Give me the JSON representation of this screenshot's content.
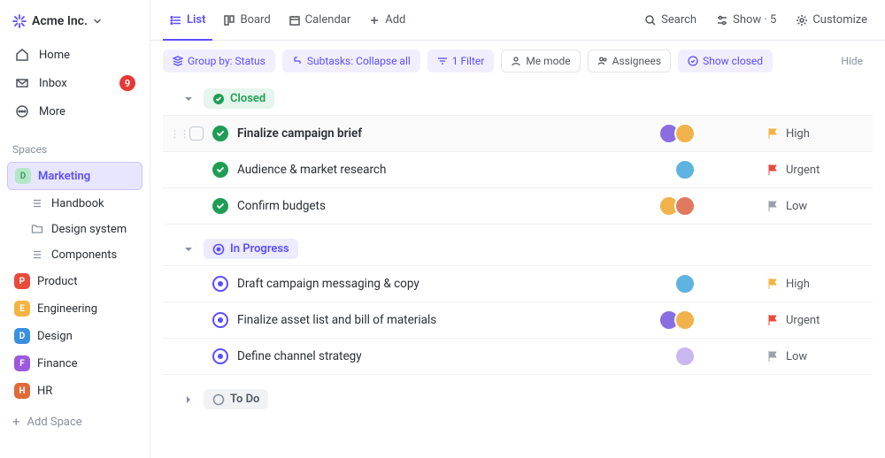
{
  "workspace": {
    "name": "Acme Inc."
  },
  "nav": {
    "home": "Home",
    "inbox": "Inbox",
    "inbox_badge": "9",
    "more": "More"
  },
  "spaces_label": "Spaces",
  "add_space": "Add Space",
  "spaces": [
    {
      "letter": "D",
      "color": "#b4e7c8",
      "text": "#3a9e5f",
      "label": "Marketing",
      "active": true,
      "children": [
        {
          "icon": "list",
          "label": "Handbook"
        },
        {
          "icon": "folder",
          "label": "Design system"
        },
        {
          "icon": "list",
          "label": "Components"
        }
      ]
    },
    {
      "letter": "P",
      "color": "#e84b3c",
      "label": "Product"
    },
    {
      "letter": "E",
      "color": "#f5b342",
      "label": "Engineering"
    },
    {
      "letter": "D",
      "color": "#3a8fe0",
      "label": "Design"
    },
    {
      "letter": "F",
      "color": "#9b59e0",
      "label": "Finance"
    },
    {
      "letter": "H",
      "color": "#e06a3a",
      "label": "HR"
    }
  ],
  "views": [
    {
      "icon": "list",
      "label": "List",
      "active": true
    },
    {
      "icon": "board",
      "label": "Board"
    },
    {
      "icon": "calendar",
      "label": "Calendar"
    },
    {
      "icon": "plus",
      "label": "Add"
    }
  ],
  "top_actions": {
    "search": "Search",
    "show": "Show · 5",
    "customize": "Customize"
  },
  "toolbar": {
    "group_by": "Group by: Status",
    "subtasks": "Subtasks: Collapse all",
    "filter": "1 Filter",
    "me_mode": "Me mode",
    "assignees": "Assignees",
    "show_closed": "Show closed",
    "hide": "Hide"
  },
  "groups": [
    {
      "id": "closed",
      "label": "Closed",
      "expanded": true,
      "tasks": [
        {
          "title": "Finalize campaign brief",
          "status": "done",
          "assignees": [
            {
              "bg": "#8a6de0"
            },
            {
              "bg": "#f2b24b"
            }
          ],
          "priority": "High",
          "flag": "#f5b342",
          "first": true
        },
        {
          "title": "Audience & market research",
          "status": "done",
          "assignees": [
            {
              "bg": "#5fb3e0"
            }
          ],
          "priority": "Urgent",
          "flag": "#e84b3c"
        },
        {
          "title": "Confirm budgets",
          "status": "done",
          "assignees": [
            {
              "bg": "#f2b24b"
            },
            {
              "bg": "#e07a5f"
            }
          ],
          "priority": "Low",
          "flag": "#9aa1ab"
        }
      ]
    },
    {
      "id": "progress",
      "label": "In Progress",
      "expanded": true,
      "tasks": [
        {
          "title": "Draft campaign messaging & copy",
          "status": "progress",
          "assignees": [
            {
              "bg": "#5fb3e0"
            }
          ],
          "priority": "High",
          "flag": "#f5b342"
        },
        {
          "title": "Finalize asset list and bill of materials",
          "status": "progress",
          "assignees": [
            {
              "bg": "#8a6de0"
            },
            {
              "bg": "#f2b24b"
            }
          ],
          "priority": "Urgent",
          "flag": "#e84b3c"
        },
        {
          "title": "Define channel strategy",
          "status": "progress",
          "assignees": [
            {
              "bg": "#c9b8f0"
            }
          ],
          "priority": "Low",
          "flag": "#9aa1ab"
        }
      ]
    },
    {
      "id": "todo",
      "label": "To Do",
      "expanded": false,
      "tasks": []
    }
  ]
}
